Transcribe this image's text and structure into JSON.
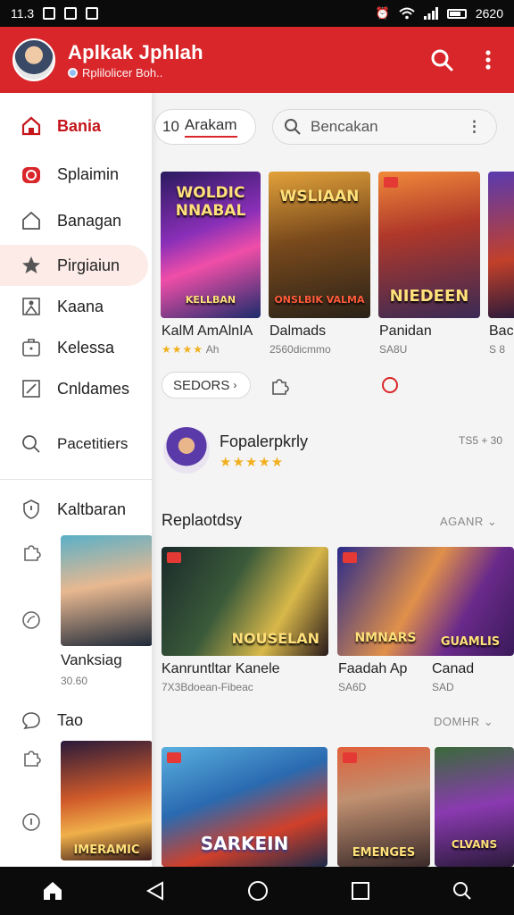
{
  "status": {
    "time": "11.3",
    "right_text": "2620"
  },
  "appbar": {
    "title": "Aplkak Jphlah",
    "subtitle": "Rplilolicer Boh.."
  },
  "drawer": {
    "items": [
      {
        "label": "Bania",
        "icon": "home-icon"
      },
      {
        "label": "Splaimin",
        "icon": "record-icon"
      },
      {
        "label": "Banagan",
        "icon": "house-icon"
      },
      {
        "label": "Pirgiaiun",
        "icon": "star-icon"
      },
      {
        "label": "Kaana",
        "icon": "person-icon"
      },
      {
        "label": "Kelessa",
        "icon": "bag-icon"
      },
      {
        "label": "Cnldames",
        "icon": "edit-icon"
      },
      {
        "label": "Pacetitiers",
        "icon": "search-icon"
      }
    ],
    "section1": "Kaltbaran",
    "card_title": "Vanksiag",
    "card_sub": "30.60",
    "section2": "Tao"
  },
  "filter": {
    "chip_label": "Arakam",
    "chip_prefix": "10"
  },
  "search": {
    "placeholder": "Bencakan"
  },
  "games": [
    {
      "title": "KalM AmAlnIA",
      "meta": "Ah",
      "poster": "WOLDIC NNABAL",
      "poster_sub": "KELLBAN"
    },
    {
      "title": "Dalmads",
      "meta": "2560dicmmo",
      "poster": "WSLIAAN",
      "poster_sub": "ONSLBIK VALMA"
    },
    {
      "title": "Panidan",
      "meta": "SA8U",
      "poster": "NIEDEEN",
      "poster_sub": ""
    },
    {
      "title": "Bac",
      "meta": "S 8",
      "poster": "",
      "poster_sub": ""
    }
  ],
  "filter2": {
    "label": "SEDORS"
  },
  "featured": {
    "title": "Fopalerpkrly",
    "right": "TS5 + 30"
  },
  "section_a": {
    "title": "Replaotdsy",
    "more": "AGANR"
  },
  "row2": [
    {
      "title": "Kanruntltar Kanele",
      "meta": "7X3Bdoean-Fibeac",
      "poster": "NOUSELAN"
    },
    {
      "title": "Faadah Ap",
      "meta": "SA6D",
      "poster": "NMNARS"
    },
    {
      "title": "Canad",
      "meta": "SAD",
      "poster": "GUAMLIS"
    }
  ],
  "section_b": {
    "more": "DOMHR"
  },
  "row3": [
    {
      "poster": "SARKEIN"
    },
    {
      "poster": "EMENGES"
    },
    {
      "poster": "CLVANS"
    }
  ],
  "drawer_posters": [
    {
      "poster": ""
    },
    {
      "poster": "IMERAMIC"
    }
  ],
  "colors": {
    "brand": "#d9262a",
    "accent_red": "#c4161c",
    "star": "#f2b01e"
  }
}
